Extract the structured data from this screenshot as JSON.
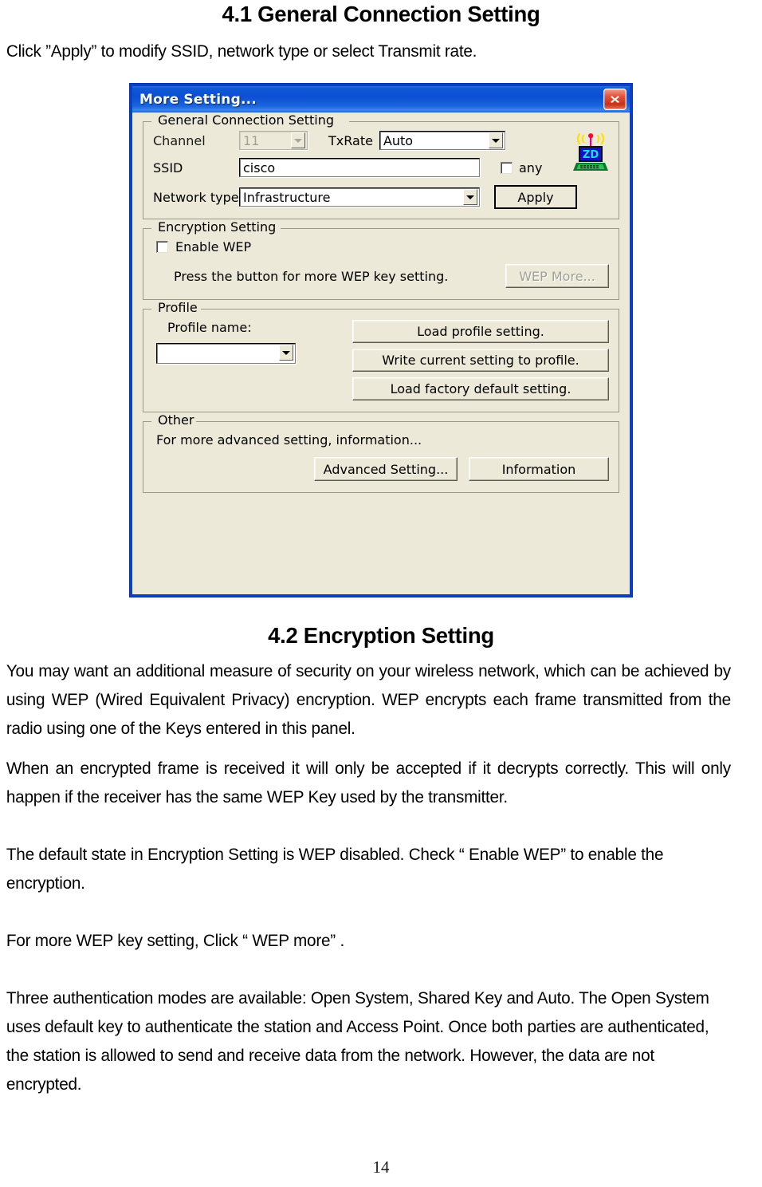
{
  "document": {
    "section_41_heading": "4.1 General Connection Setting",
    "intro_paragraph": "Click ”Apply” to modify SSID, network type or select Transmit rate.",
    "section_42_heading": "4.2 Encryption Setting",
    "paragraph_1": "You may want an additional measure of security on your wireless network, which can be achieved by using WEP (Wired Equivalent Privacy) encryption. WEP encrypts each frame transmitted from the radio using one of the Keys entered in this panel.",
    "paragraph_2": "When an encrypted frame is received it will only be accepted if it decrypts correctly. This will only happen if the receiver has the same WEP Key used by the transmitter.",
    "paragraph_3": "The default state in Encryption Setting is WEP disabled. Check “ Enable WEP” to enable the encryption.",
    "paragraph_4": "For more WEP key setting, Click “ WEP more” .",
    "paragraph_5": "Three authentication modes are available: Open System, Shared Key and Auto. The Open System uses default key to authenticate the station and Access Point. Once both parties are authenticated, the station is allowed to send and receive data from the network. However, the data are not encrypted.",
    "page_number": "14"
  },
  "dialog": {
    "title": "More Setting...",
    "close_icon": "close-icon",
    "colors": {
      "titlebar_blue": "#0b4fd4",
      "frame_blue": "#0a3fc8",
      "dialog_face": "#ece9d8",
      "close_red": "#c8301a"
    },
    "general_group": {
      "legend": "General Connection Setting",
      "channel_label": "Channel",
      "channel_value": "11",
      "channel_disabled": true,
      "txrate_label": "TxRate",
      "txrate_value": "Auto",
      "ssid_label": "SSID",
      "ssid_value": "cisco",
      "any_label": "any",
      "any_checked": false,
      "network_type_label": "Network type",
      "network_type_value": "Infrastructure",
      "apply_label": "Apply",
      "logo_icon": "zydas-wireless-laptop-icon",
      "logo_text": "ZD"
    },
    "encryption_group": {
      "legend": "Encryption Setting",
      "enable_wep_label": "Enable WEP",
      "enable_wep_checked": false,
      "hint_text": "Press the button for more WEP key setting.",
      "wep_more_label": "WEP More...",
      "wep_more_disabled": true
    },
    "profile_group": {
      "legend": "Profile",
      "profile_name_label": "Profile name:",
      "profile_name_value": "",
      "load_profile_label": "Load profile setting.",
      "write_profile_label": "Write current setting to profile.",
      "load_factory_label": "Load factory default setting."
    },
    "other_group": {
      "legend": "Other",
      "description": "For more advanced setting, information...",
      "advanced_setting_label": "Advanced Setting...",
      "information_label": "Information"
    }
  }
}
